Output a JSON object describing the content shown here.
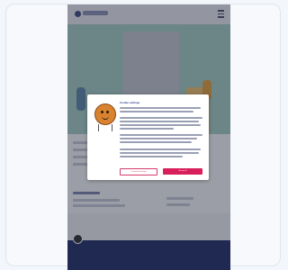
{
  "cookie_banner": {
    "title": "Cookie settings",
    "customize_label": "Customize settings",
    "accept_label": "Accept all"
  },
  "colors": {
    "brand": "#2c3a8c",
    "accent": "#d81e5b",
    "footer": "#1d2a63"
  }
}
